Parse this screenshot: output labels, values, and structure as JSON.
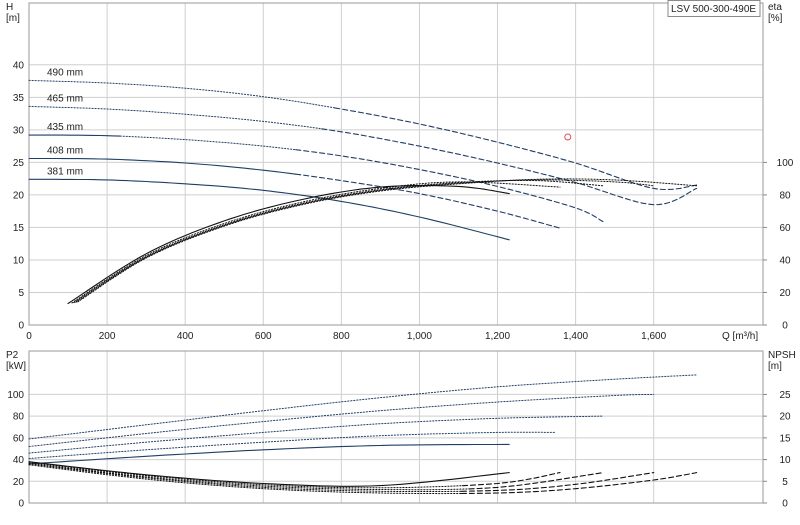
{
  "chart_data": [
    {
      "id": "head",
      "type": "line",
      "title": "LSV 500-300-490E",
      "xlabel": "Q [m³/h]",
      "ylabel_left": "H\n[m]",
      "ylabel_right": "eta\n[%]",
      "xlim": [
        0,
        1880
      ],
      "ylim": [
        0,
        49.5
      ],
      "xticks": [
        0,
        200,
        400,
        600,
        800,
        1000,
        1200,
        1400,
        1600
      ],
      "xtick_labels": [
        "0",
        "200",
        "400",
        "600",
        "800",
        "1,000",
        "1,200",
        "1,400",
        "1,600"
      ],
      "yticks": [
        0,
        5,
        10,
        15,
        20,
        25,
        30,
        35,
        40
      ],
      "eta_ticks": [
        0,
        20,
        40,
        60,
        80,
        100
      ],
      "eta_scale": {
        "zero_at_H": 0,
        "hundred_at_H": 25
      },
      "grid": true,
      "series": [
        {
          "name": "490 mm",
          "style": "dotted_then_dashed",
          "split_x": 800,
          "x": [
            0,
            200,
            400,
            600,
            800,
            1000,
            1200,
            1400,
            1600,
            1710
          ],
          "y": [
            37.6,
            37.2,
            36.4,
            35.1,
            33.2,
            30.9,
            28.1,
            24.9,
            21.0,
            21.5
          ]
        },
        {
          "name": "465 mm",
          "style": "dotted_then_dashed",
          "split_x": 760,
          "x": [
            0,
            200,
            400,
            600,
            800,
            1000,
            1200,
            1400,
            1600,
            1710
          ],
          "y": [
            33.6,
            33.2,
            32.4,
            31.3,
            29.7,
            27.5,
            24.9,
            21.9,
            18.5,
            21.0
          ]
        },
        {
          "name": "435 mm",
          "style": "solid_dotted_dashed",
          "split_x": [
            240,
            700
          ],
          "x": [
            0,
            200,
            400,
            600,
            800,
            1000,
            1200,
            1400,
            1470
          ],
          "y": [
            29.2,
            29.1,
            28.5,
            27.5,
            26.0,
            23.9,
            21.3,
            18.0,
            15.9
          ]
        },
        {
          "name": "408 mm",
          "style": "solid_then_dashed",
          "split_x": 700,
          "x": [
            0,
            200,
            400,
            600,
            800,
            1000,
            1200,
            1360
          ],
          "y": [
            25.6,
            25.5,
            24.9,
            23.8,
            22.2,
            20.2,
            17.5,
            14.9
          ]
        },
        {
          "name": "381 mm",
          "style": "solid",
          "x": [
            0,
            200,
            400,
            600,
            800,
            1000,
            1230
          ],
          "y": [
            22.4,
            22.3,
            21.7,
            20.7,
            19.0,
            16.6,
            13.1
          ]
        },
        {
          "name": "",
          "role": "efficiency",
          "unit": "%",
          "style": "solid",
          "x": [
            100,
            300,
            500,
            700,
            900,
            1100,
            1230
          ],
          "y": [
            13.2,
            43.8,
            64.0,
            77.2,
            84.8,
            85.2,
            80.8
          ]
        },
        {
          "name": "",
          "role": "efficiency",
          "unit": "%",
          "style": "dotted",
          "x": [
            110,
            300,
            500,
            700,
            900,
            1100,
            1360
          ],
          "y": [
            13.6,
            42.8,
            62.4,
            75.6,
            84.0,
            88.0,
            84.8
          ]
        },
        {
          "name": "",
          "role": "efficiency",
          "unit": "%",
          "style": "dotted",
          "x": [
            115,
            300,
            500,
            700,
            900,
            1100,
            1300,
            1470
          ],
          "y": [
            13.8,
            42.0,
            61.6,
            74.8,
            83.2,
            87.6,
            88.8,
            85.6
          ]
        },
        {
          "name": "",
          "role": "efficiency",
          "unit": "%",
          "style": "dotted",
          "x": [
            120,
            300,
            500,
            700,
            900,
            1100,
            1300,
            1500,
            1600
          ],
          "y": [
            14.0,
            41.6,
            61.2,
            74.4,
            82.8,
            87.2,
            89.2,
            88.0,
            85.6
          ]
        },
        {
          "name": "",
          "role": "efficiency",
          "unit": "%",
          "style": "dotted",
          "x": [
            125,
            300,
            500,
            700,
            900,
            1100,
            1300,
            1500,
            1710
          ],
          "y": [
            14.2,
            41.2,
            60.8,
            74.0,
            82.4,
            86.8,
            89.6,
            89.2,
            85.6
          ]
        }
      ],
      "markers": [
        {
          "type": "circle",
          "x": 1380,
          "y": 28.9,
          "color": "#e05050"
        }
      ]
    },
    {
      "id": "power_npsh",
      "type": "line",
      "ylabel_left": "P2\n[kW]",
      "ylabel_right": "NPSH\n[m]",
      "xlim": [
        0,
        1880
      ],
      "ylim": [
        0,
        140
      ],
      "xticks": [
        0,
        200,
        400,
        600,
        800,
        1000,
        1200,
        1400,
        1600
      ],
      "yticks": [
        0,
        20,
        40,
        60,
        80,
        100
      ],
      "npsh_ticks": [
        0,
        5,
        10,
        15,
        20,
        25
      ],
      "npsh_scale": {
        "zero_at_P2": 0,
        "twentyfive_at_P2": 100
      },
      "grid": true,
      "series": [
        {
          "name": "490 mm",
          "role": "power",
          "unit": "kW",
          "style": "dotted",
          "x": [
            0,
            300,
            600,
            900,
            1200,
            1500,
            1710
          ],
          "y": [
            59,
            72,
            85,
            97,
            107,
            114,
            118
          ]
        },
        {
          "name": "465 mm",
          "role": "power",
          "unit": "kW",
          "style": "dotted",
          "x": [
            0,
            300,
            600,
            900,
            1200,
            1500,
            1600
          ],
          "y": [
            52,
            64,
            75,
            85,
            93,
            99,
            100
          ]
        },
        {
          "name": "435 mm",
          "role": "power",
          "unit": "kW",
          "style": "dotted",
          "x": [
            0,
            300,
            600,
            900,
            1200,
            1470
          ],
          "y": [
            46,
            56,
            65,
            73,
            78,
            80
          ]
        },
        {
          "name": "408 mm",
          "role": "power",
          "unit": "kW",
          "style": "dotted",
          "x": [
            0,
            300,
            600,
            900,
            1200,
            1350
          ],
          "y": [
            41,
            49,
            56,
            62,
            65,
            65
          ]
        },
        {
          "name": "381 mm",
          "role": "power",
          "unit": "kW",
          "style": "solid",
          "x": [
            0,
            300,
            600,
            900,
            1230
          ],
          "y": [
            36,
            43,
            49,
            53,
            54
          ]
        },
        {
          "name": "381 mm",
          "role": "npsh",
          "unit": "m",
          "style": "solid",
          "x": [
            0,
            300,
            600,
            900,
            1230
          ],
          "y": [
            9.5,
            6.5,
            4.5,
            4.0,
            7.0
          ]
        },
        {
          "name": "408 mm",
          "role": "npsh",
          "unit": "m",
          "style": "dotted_then_dashed",
          "split_x": 1130,
          "x": [
            0,
            300,
            600,
            900,
            1200,
            1360
          ],
          "y": [
            9.3,
            6.3,
            4.2,
            3.5,
            4.5,
            7.0
          ]
        },
        {
          "name": "435 mm",
          "role": "npsh",
          "unit": "m",
          "style": "dotted_then_dashed",
          "split_x": 1130,
          "x": [
            0,
            300,
            600,
            900,
            1200,
            1470
          ],
          "y": [
            9.1,
            6.0,
            3.9,
            3.1,
            3.6,
            7.0
          ]
        },
        {
          "name": "465 mm",
          "role": "npsh",
          "unit": "m",
          "style": "dotted_then_dashed",
          "split_x": 1130,
          "x": [
            0,
            300,
            600,
            900,
            1200,
            1400,
            1600
          ],
          "y": [
            9.0,
            5.8,
            3.6,
            2.7,
            2.9,
            4.3,
            7.0
          ]
        },
        {
          "name": "490 mm",
          "role": "npsh",
          "unit": "m",
          "style": "dotted_then_dashed",
          "split_x": 1130,
          "x": [
            0,
            300,
            600,
            900,
            1200,
            1400,
            1600,
            1710
          ],
          "y": [
            8.8,
            5.5,
            3.3,
            2.3,
            2.3,
            3.3,
            5.3,
            7.0
          ]
        }
      ]
    }
  ]
}
